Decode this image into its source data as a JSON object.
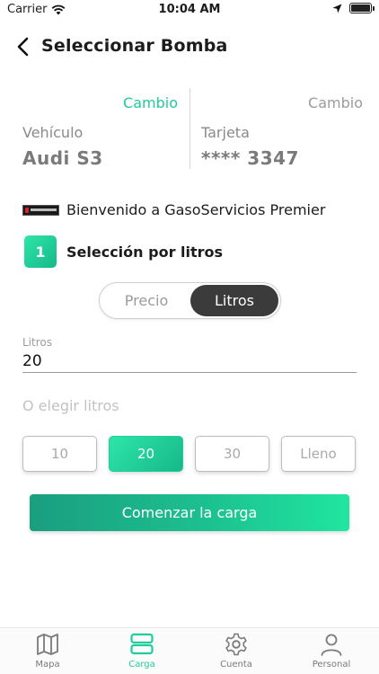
{
  "status": {
    "carrier": "Carrier",
    "time": "10:04 AM"
  },
  "header": {
    "title": "Seleccionar Bomba"
  },
  "vehicle": {
    "change_label": "Cambio",
    "label": "Vehículo",
    "value": "Audi S3"
  },
  "card": {
    "change_label": "Cambio",
    "label": "Tarjeta",
    "value": "**** 3347"
  },
  "station": {
    "welcome": "Bienvenido a GasoServicios Premier"
  },
  "step": {
    "number": "1",
    "label": "Selección por litros"
  },
  "mode_toggle": {
    "options": [
      "Precio",
      "Litros"
    ],
    "selected": "Litros"
  },
  "liters_input": {
    "label": "Litros",
    "value": "20"
  },
  "quick_select": {
    "label": "O elegir litros",
    "options": [
      "10",
      "20",
      "30",
      "Lleno"
    ],
    "selected": "20"
  },
  "start_button": {
    "label": "Comenzar la carga"
  },
  "tabs": [
    {
      "label": "Mapa",
      "icon": "map-icon"
    },
    {
      "label": "Carga",
      "icon": "fuel-load-icon",
      "active": true
    },
    {
      "label": "Cuenta",
      "icon": "gear-icon"
    },
    {
      "label": "Personal",
      "icon": "person-icon"
    }
  ],
  "colors": {
    "accent": "#1fcc9b",
    "dark": "#3b3b3b"
  }
}
